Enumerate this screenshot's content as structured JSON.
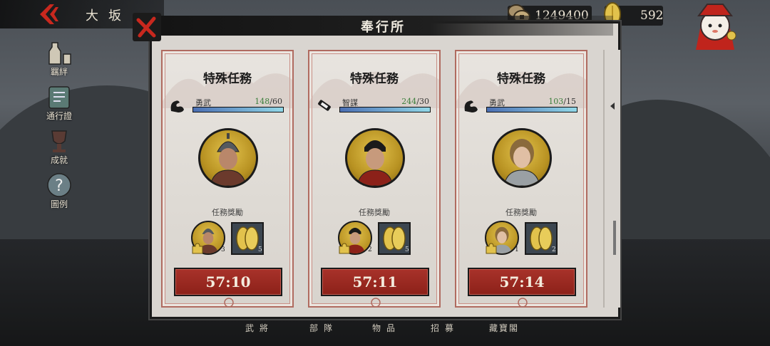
{
  "header": {
    "city": "大坂",
    "panel_title": "奉行所"
  },
  "currency": {
    "coins": "1249400",
    "gold": "592"
  },
  "sidebar": {
    "items": [
      {
        "label": "羈絆",
        "icon": "sake-bottle-icon"
      },
      {
        "label": "通行證",
        "icon": "pass-ticket-icon"
      },
      {
        "label": "成就",
        "icon": "trophy-icon"
      },
      {
        "label": "圖例",
        "icon": "question-icon"
      }
    ]
  },
  "cards": [
    {
      "title": "特殊任務",
      "stat_icon": "muscle-arm-icon",
      "stat_name": "勇武",
      "stat_current": "148",
      "stat_required": "/60",
      "stat_fill": 1.0,
      "reward_label": "任務獎勵",
      "reward_hero_count": "3",
      "reward_gold_count": "5",
      "timer": "57:10"
    },
    {
      "title": "特殊任務",
      "stat_icon": "scroll-wisdom-icon",
      "stat_name": "智謀",
      "stat_current": "244",
      "stat_required": "/30",
      "stat_fill": 1.0,
      "reward_label": "任務獎勵",
      "reward_hero_count": "2",
      "reward_gold_count": "5",
      "timer": "57:11"
    },
    {
      "title": "特殊任務",
      "stat_icon": "muscle-arm-icon",
      "stat_name": "勇武",
      "stat_current": "103",
      "stat_required": "/15",
      "stat_fill": 1.0,
      "reward_label": "任務獎勵",
      "reward_hero_count": "1",
      "reward_gold_count": "2",
      "timer": "57:14"
    }
  ],
  "bottom_tabs": [
    "武將",
    "部隊",
    "物品",
    "招募",
    "藏寶閣"
  ],
  "colors": {
    "accent_red": "#a8322a",
    "stat_green": "#3a7e3a",
    "gold": "#e2c24c"
  }
}
